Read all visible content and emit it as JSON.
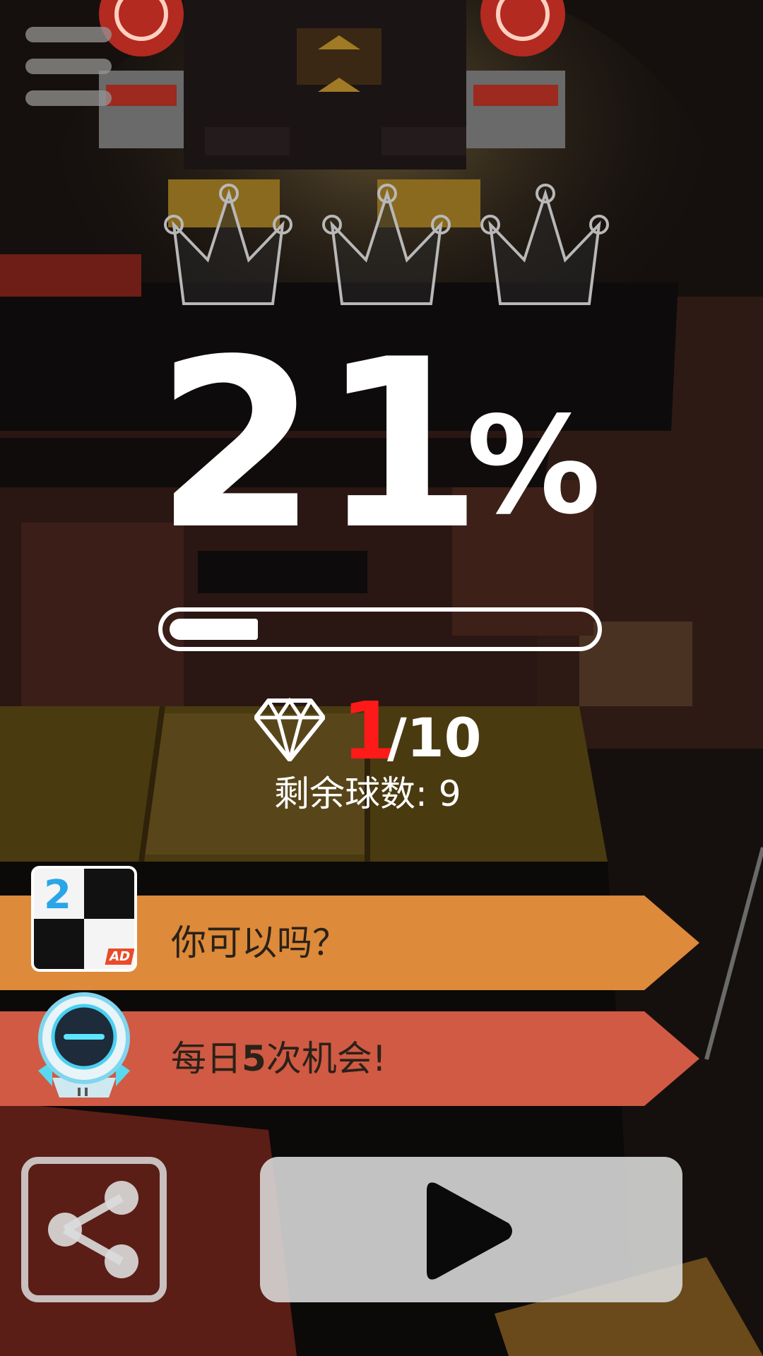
{
  "menu": {
    "icon": "hamburger-menu-icon"
  },
  "crowns": {
    "total": 3,
    "earned": 0,
    "icon": "crown-icon"
  },
  "progress": {
    "percent_value": "21",
    "percent_sign": "%",
    "fill_fraction": 0.21
  },
  "gems": {
    "icon": "diamond-icon",
    "current": "1",
    "total_text": "/10"
  },
  "balls": {
    "label": "剩余球数: 9"
  },
  "banners": {
    "ad": {
      "text": "你可以吗？",
      "color": "#dd8a3a",
      "icon": "piano-tiles-2-ad-icon",
      "icon_number": "2",
      "ad_badge": "AD"
    },
    "daily": {
      "text_prefix": "每日",
      "text_bold": "5",
      "text_suffix": "次机会!",
      "color": "#d05a44",
      "icon": "robot-helmet-icon"
    }
  },
  "buttons": {
    "share": {
      "icon": "share-icon"
    },
    "play": {
      "icon": "play-icon"
    }
  },
  "colors": {
    "accent_red": "#ff1a1a",
    "text": "#ffffff",
    "background": "#0d0b0a"
  }
}
